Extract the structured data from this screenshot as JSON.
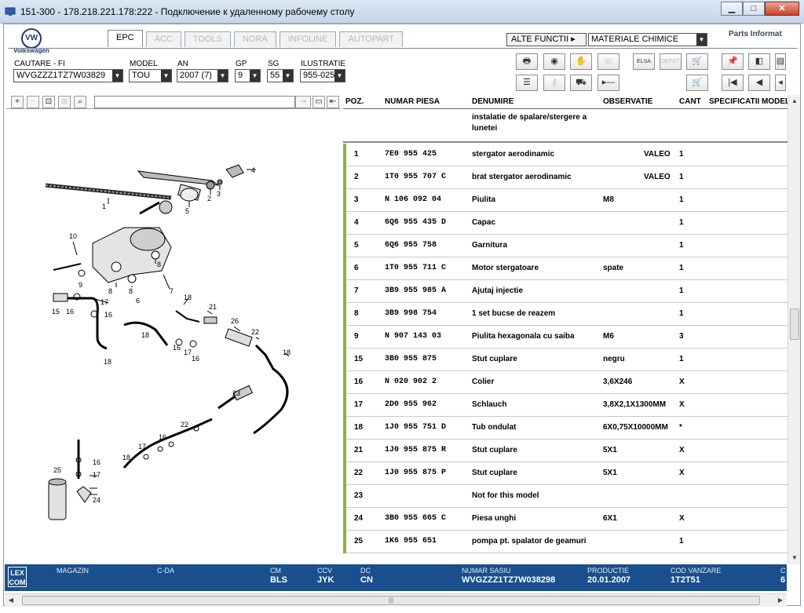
{
  "window": {
    "title": "151-300 - 178.218.221.178:222 - Подключение к удаленному рабочему столу",
    "minimize": "▁",
    "maximize": "□",
    "close": "✕"
  },
  "brand": {
    "logo_text": "VW",
    "name": "Volkswagen",
    "parts_info": "Parts Informat"
  },
  "tabs": [
    {
      "label": "EPC",
      "active": true
    },
    {
      "label": "ACC"
    },
    {
      "label": "TOOLS"
    },
    {
      "label": "NORA"
    },
    {
      "label": "INFOLINE"
    },
    {
      "label": "AUTOPART"
    }
  ],
  "alte_functii": {
    "label": "ALTE FUNCTII ▸",
    "selected": "MATERIALE CHIMICE"
  },
  "search": {
    "fi": {
      "label": "CAUTARE - FI",
      "value": "WVGZZZ1TZ7W03829"
    },
    "model": {
      "label": "MODEL",
      "value": "TOU"
    },
    "an": {
      "label": "AN",
      "value": "2007 (7)"
    },
    "gp": {
      "label": "GP",
      "value": "9"
    },
    "sg": {
      "label": "SG",
      "value": "55"
    },
    "ilustratie": {
      "label": "ILUSTRATIE",
      "value": "955-025"
    }
  },
  "toolbar": {
    "icons": [
      {
        "name": "print-icon",
        "glyph": "🖶"
      },
      {
        "name": "disc-icon",
        "glyph": "◉"
      },
      {
        "name": "handshake-icon",
        "glyph": "✋"
      },
      {
        "name": "search-phone-icon",
        "glyph": "☏",
        "disabled": true
      },
      {
        "name": "elsa-icon",
        "glyph": "ELSA"
      },
      {
        "name": "depot-icon",
        "glyph": "DEPOT",
        "disabled": true
      },
      {
        "name": "cart-add-icon",
        "glyph": "🛒"
      },
      {
        "name": "pin-icon",
        "glyph": "📌"
      },
      {
        "name": "book-prev-icon",
        "glyph": "◧"
      },
      {
        "name": "book-next-icon",
        "glyph": "▤"
      },
      {
        "name": "list-icon",
        "glyph": "☰"
      },
      {
        "name": "key-icon",
        "glyph": "⚷",
        "disabled": true
      },
      {
        "name": "vehicle-icon",
        "glyph": "⛟"
      },
      {
        "name": "next-dash-icon",
        "glyph": "▸—"
      },
      {
        "name": "cart-icon",
        "glyph": "🛒"
      },
      {
        "name": "first-page-icon",
        "glyph": "|◀"
      },
      {
        "name": "prev-page-icon",
        "glyph": "◀"
      },
      {
        "name": "back-icon",
        "glyph": "◂"
      }
    ]
  },
  "illus_toolbar": {
    "zoom_in": "+",
    "zoom_out": "−",
    "zoom_fit": "⊡",
    "zoom_window": "⊞",
    "zoom_search": "⌕",
    "view_a": "⇥",
    "view_b": "▭",
    "view_c": "⇤"
  },
  "parts_table": {
    "headers": {
      "poz": "POZ.",
      "numar": "NUMAR PIESA",
      "denumire": "DENUMIRE",
      "observatie": "OBSERVATIE",
      "cant": "CANT",
      "spec": "SPECIFICATII MODEL"
    },
    "group_title": "instalatie de spalare/stergere a lunetei",
    "rows": [
      {
        "poz": "1",
        "nr": "7E0  955  425",
        "den": "stergator aerodinamic",
        "obs": "VALEO",
        "cant": "1"
      },
      {
        "poz": "2",
        "nr": "1T0  955  707  C",
        "den": "brat stergator aerodinamic",
        "obs": "VALEO",
        "cant": "1"
      },
      {
        "poz": "3",
        "nr": "N    106  092  04",
        "den": "Piulita",
        "obs": "M8",
        "cant": "1"
      },
      {
        "poz": "4",
        "nr": "6Q6  955  435  D",
        "den": "Capac",
        "obs": "",
        "cant": "1"
      },
      {
        "poz": "5",
        "nr": "6Q6  955  758",
        "den": "Garnitura",
        "obs": "",
        "cant": "1"
      },
      {
        "poz": "6",
        "nr": "1T0  955  711  C",
        "den": "Motor stergatoare",
        "obs": "spate",
        "cant": "1"
      },
      {
        "poz": "7",
        "nr": "3B9  955  985  A",
        "den": "Ajutaj injectie",
        "obs": "",
        "cant": "1"
      },
      {
        "poz": "8",
        "nr": "3B9  998  754",
        "den": "1 set bucse de reazem",
        "obs": "",
        "cant": "1"
      },
      {
        "poz": "9",
        "nr": "N    907  143  03",
        "den": "Piulita hexagonala cu saiba",
        "obs": "M6",
        "cant": "3"
      },
      {
        "poz": "15",
        "nr": "3B0  955  875",
        "den": "Stut cuplare",
        "obs": "negru",
        "cant": "1"
      },
      {
        "poz": "16",
        "nr": "N    020  902  2",
        "den": "Colier",
        "obs": "3,6X246",
        "cant": "X"
      },
      {
        "poz": "17",
        "nr": "2D0  955  962",
        "den": "Schlauch",
        "obs": "3,8X2,1X1300MM",
        "cant": "X"
      },
      {
        "poz": "18",
        "nr": "1J0  955  751  D",
        "den": "Tub ondulat",
        "obs": "6X0,75X10000MM",
        "cant": "*"
      },
      {
        "poz": "21",
        "nr": "1J0  955  875  R",
        "den": "Stut cuplare",
        "obs": "5X1",
        "cant": "X"
      },
      {
        "poz": "22",
        "nr": "1J0  955  875  P",
        "den": "Stut cuplare",
        "obs": "5X1",
        "cant": "X"
      },
      {
        "poz": "23",
        "nr": "",
        "den": "Not for this model",
        "obs": "",
        "cant": ""
      },
      {
        "poz": "24",
        "nr": "3B0  955  665  C",
        "den": "Piesa unghi",
        "obs": "6X1",
        "cant": "X"
      },
      {
        "poz": "25",
        "nr": "1K6  955  651",
        "den": "pompa pt. spalator de geamuri",
        "obs": "",
        "cant": "1"
      }
    ]
  },
  "diagram_labels": [
    "1",
    "2",
    "3",
    "4",
    "5",
    "6",
    "7",
    "8",
    "8",
    "8",
    "9",
    "10",
    "15",
    "16",
    "16",
    "16",
    "16",
    "16",
    "16",
    "17",
    "17",
    "17",
    "17",
    "18",
    "18",
    "18",
    "18",
    "18",
    "21",
    "22",
    "22",
    "23",
    "24",
    "25",
    "26"
  ],
  "status": {
    "logo": "LEX\nCON",
    "magazin": {
      "label": "MAGAZIN",
      "value": ""
    },
    "cda": {
      "label": "C-DA",
      "value": ""
    },
    "cm": {
      "label": "CM",
      "value": "BLS"
    },
    "ccv": {
      "label": "CCV",
      "value": "JYK"
    },
    "dc": {
      "label": "DC",
      "value": "CN"
    },
    "sasiu": {
      "label": "NUMAR SASIU",
      "value": "WVGZZZ1TZ7W038298"
    },
    "productie": {
      "label": "PRODUCTIE",
      "value": "20.01.2007"
    },
    "vanzare": {
      "label": "COD VANZARE",
      "value": "1T2T51"
    },
    "extra": {
      "label": "C",
      "value": "6"
    }
  },
  "scroll": {
    "up": "▲",
    "down": "▼",
    "left": "◀",
    "right": "▶",
    "grip": "|||"
  },
  "colors": {
    "accent_bar": "#8db339",
    "status_bg": "#1a4f8d"
  }
}
